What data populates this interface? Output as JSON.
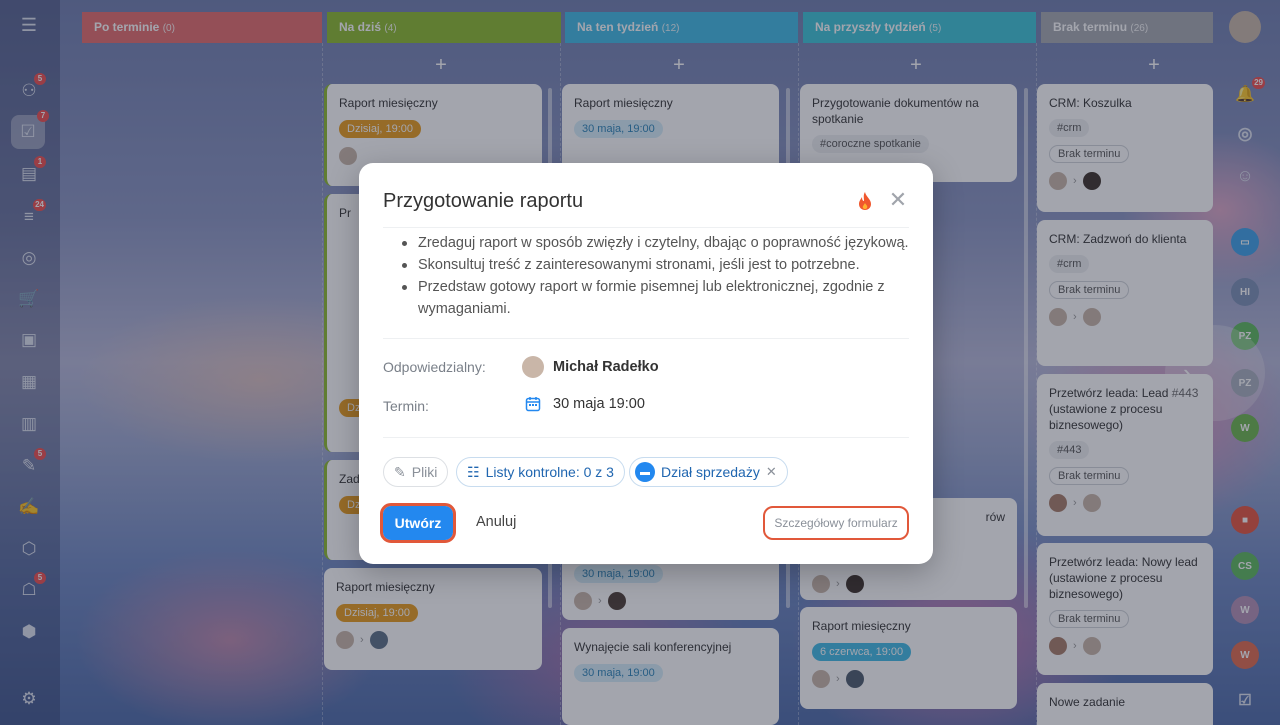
{
  "columns": [
    {
      "name": "Po terminie",
      "count": "(0)",
      "color": "#e66b6b"
    },
    {
      "name": "Na dziś",
      "count": "(4)",
      "color": "#8cba2c"
    },
    {
      "name": "Na ten tydzień",
      "count": "(12)",
      "color": "#3ebbe6"
    },
    {
      "name": "Na przyszły tydzień",
      "count": "(5)",
      "color": "#3bc4d7"
    },
    {
      "name": "Brak terminu",
      "count": "(26)",
      "color": "#a6aab0"
    }
  ],
  "plus": "+",
  "cards": {
    "c1": {
      "title": "Raport miesięczny",
      "pill": "Dzisiaj, 19:00"
    },
    "c2": {
      "title": "Pr"
    },
    "c3": {
      "title": "Dz"
    },
    "c4": {
      "title": "Zadz",
      "pill": "Dz"
    },
    "c5": {
      "title": "Raport miesięczny",
      "pill": "Dzisiaj, 19:00"
    },
    "t1": {
      "title": "Raport miesięczny",
      "pill": "30 maja, 19:00"
    },
    "t2": {
      "pill": "30 maja, 19:00"
    },
    "t3": {
      "title": "Wynajęcie sali konferencyjnej",
      "pill": "30 maja, 19:00"
    },
    "p1": {
      "title": "Przygotowanie dokumentów na spotkanie",
      "tag": "#coroczne spotkanie"
    },
    "p2": {
      "title": "rów"
    },
    "p3": {
      "title": "Raport miesięczny",
      "pill": "6 czerwca, 19:00"
    },
    "b1": {
      "title": "CRM: Koszulka",
      "tag": "#crm",
      "term": "Brak terminu"
    },
    "b2": {
      "title": "CRM: Zadzwoń do klienta",
      "tag": "#crm",
      "term": "Brak terminu"
    },
    "b3": {
      "title": "Przetwórz leada: Lead #443 (ustawione z procesu biznesowego)",
      "tag": "#443",
      "term": "Brak terminu"
    },
    "b4": {
      "title": "Przetwórz leada: Nowy lead (ustawione z procesu biznesowego)",
      "term": "Brak terminu"
    },
    "b5": {
      "title": "Nowe zadanie"
    }
  },
  "leftbar_badges": {
    "b1": "5",
    "b2": "7",
    "b3": "1",
    "b4": "24",
    "b5": "5",
    "b6": "5"
  },
  "rightbar": {
    "notif": "29",
    "pz1": "PZ",
    "pz2": "PZ",
    "w1": "W",
    "w2": "W",
    "w3": "W",
    "cs": "CS",
    "hi": "HI"
  },
  "modal": {
    "title": "Przygotowanie raportu",
    "bullets": [
      "Zredaguj raport w sposób zwięzły i czytelny, dbając o poprawność językową.",
      "Skonsultuj treść z zainteresowanymi stronami, jeśli jest to potrzebne.",
      "Przedstaw gotowy raport w formie pisemnej lub elektronicznej, zgodnie z wymaganiami."
    ],
    "responsible_label": "Odpowiedzialny:",
    "responsible_name": "Michał Radełko",
    "deadline_label": "Termin:",
    "deadline_value": "30 maja 19:00",
    "files_label": "Pliki",
    "checklists_label": "Listy kontrolne: 0 z 3",
    "department_label": "Dział sprzedaży",
    "create_label": "Utwórz",
    "cancel_label": "Anuluj",
    "full_form_label": "Szczegółowy formularz"
  }
}
